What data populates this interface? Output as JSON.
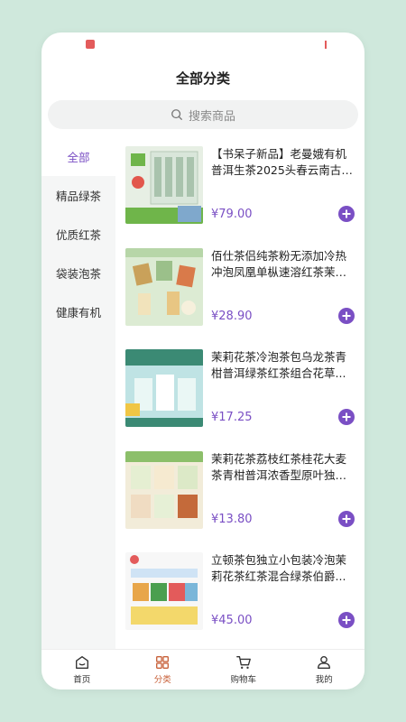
{
  "header": {
    "title": "全部分类"
  },
  "search": {
    "placeholder": "搜索商品"
  },
  "sidebar": {
    "items": [
      {
        "label": "全部",
        "active": true
      },
      {
        "label": "精品绿茶"
      },
      {
        "label": "优质红茶"
      },
      {
        "label": "袋装泡茶"
      },
      {
        "label": "健康有机"
      }
    ]
  },
  "products": [
    {
      "title": "【书呆子新品】老曼娥有机普洱生茶2025头春云南古树...",
      "price": "¥79.00",
      "thumb_colors": [
        "#6fb54a",
        "#e8f0e6",
        "#7fa8cc"
      ]
    },
    {
      "title": "佰仕茶侣纯茶粉无添加冷热冲泡凤凰单枞速溶红茶茉莉...",
      "price": "¥28.90",
      "thumb_colors": [
        "#d8e9d0",
        "#c9a15a",
        "#9bc08a"
      ]
    },
    {
      "title": "茉莉花茶冷泡茶包乌龙茶青柑普洱绿茶红茶组合花草...",
      "price": "¥17.25",
      "thumb_colors": [
        "#3b8a74",
        "#bfe3e4",
        "#f0c645"
      ]
    },
    {
      "title": "茉莉花茶荔枝红茶桂花大麦茶青柑普洱浓香型原叶独立...",
      "price": "¥13.80",
      "thumb_colors": [
        "#8cbf6a",
        "#f2e4c8",
        "#c46a3a"
      ]
    },
    {
      "title": "立顿茶包独立小包装冷泡茉莉花茶红茶混合绿茶伯爵...",
      "price": "¥45.00",
      "thumb_colors": [
        "#f4f4f4",
        "#e8a64a",
        "#4a9f4f"
      ]
    }
  ],
  "tabbar": {
    "items": [
      {
        "label": "首页",
        "icon": "home-icon"
      },
      {
        "label": "分类",
        "icon": "category-icon",
        "active": true
      },
      {
        "label": "购物车",
        "icon": "cart-icon"
      },
      {
        "label": "我的",
        "icon": "user-icon"
      }
    ]
  },
  "colors": {
    "accent": "#7a4fc4",
    "active_tab": "#c8613a",
    "background": "#cfe8dc"
  }
}
